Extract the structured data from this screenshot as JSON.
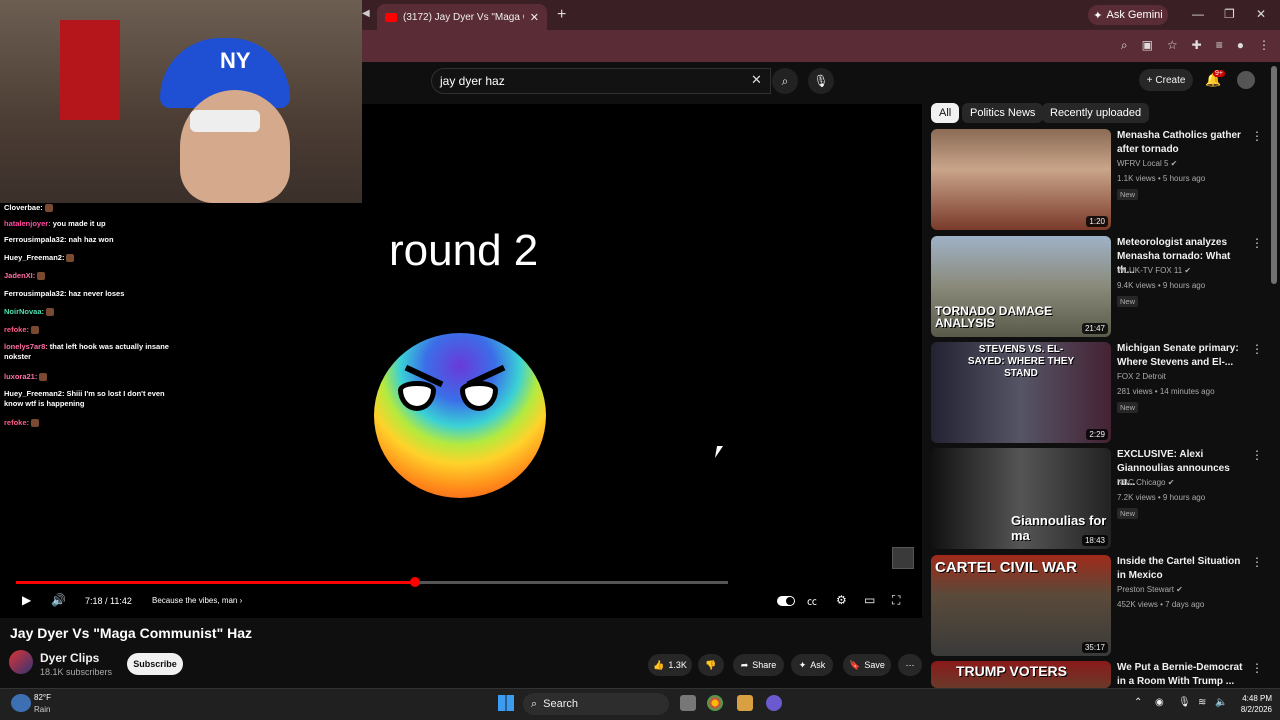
{
  "browser": {
    "tab_title": "(3172) Jay Dyer Vs \"Maga Comm",
    "ask_gemini": "Ask Gemini"
  },
  "header": {
    "search_value": "jay dyer haz",
    "create_label": "Create",
    "notif_count": "9+"
  },
  "chat": {
    "lines": [
      {
        "user": "Cloverbae:",
        "text": "",
        "color": "#ffffff"
      },
      {
        "user": "hatalenjoyer:",
        "text": "you made it up",
        "color": "#ff4aa0"
      },
      {
        "user": "Ferrousimpala32:",
        "text": "nah haz won",
        "color": "#ffffff"
      },
      {
        "user": "Huey_Freeman2:",
        "text": "",
        "color": "#ffffff"
      },
      {
        "user": "JadenXI:",
        "text": "",
        "color": "#ff6fa5"
      },
      {
        "user": "Ferrousimpala32:",
        "text": "haz never loses",
        "color": "#ffffff"
      },
      {
        "user": "NoirNovaa:",
        "text": "",
        "color": "#4ee0b0"
      },
      {
        "user": "refoke:",
        "text": "",
        "color": "#ff5c8a"
      },
      {
        "user": "lonelys7ar8:",
        "text": "that left hook was actually insane nokster",
        "color": "#ff6fa5"
      },
      {
        "user": "luxora21:",
        "text": "",
        "color": "#ff6fa5"
      },
      {
        "user": "Huey_Freeman2:",
        "text": "Shiii I'm so lost I don't even know wtf is happening",
        "color": "#ffffff"
      },
      {
        "user": "refoke:",
        "text": "",
        "color": "#ff5c8a"
      }
    ]
  },
  "video": {
    "overlay_text": "round 2",
    "progress": 0.63,
    "buffered": 1.0,
    "time": "7:18 / 11:42",
    "chapter": "Because the vibes, man",
    "title": "Jay Dyer Vs \"Maga Communist\" Haz",
    "channel": "Dyer Clips",
    "subscribers": "18.1K subscribers",
    "subscribe_label": "Subscribe",
    "likes": "1.3K",
    "share_label": "Share",
    "ask_label": "Ask",
    "save_label": "Save"
  },
  "chips": [
    "All",
    "Politics News",
    "Recently uploaded"
  ],
  "recommendations": [
    {
      "title": "Menasha Catholics gather after tornado",
      "channel": "WFRV Local 5",
      "verified": true,
      "meta": "1.1K views • 5 hours ago",
      "badge": "New",
      "duration": "1:20",
      "thumb_text": ""
    },
    {
      "title": "Meteorologist analyzes Menasha tornado: What th...",
      "channel": "WLUK-TV FOX 11",
      "verified": true,
      "meta": "9.4K views • 9 hours ago",
      "badge": "New",
      "duration": "21:47",
      "thumb_text": "TORNADO DAMAGE ANALYSIS"
    },
    {
      "title": "Michigan Senate primary: Where Stevens and El-...",
      "channel": "FOX 2 Detroit",
      "verified": false,
      "meta": "281 views • 14 minutes ago",
      "badge": "New",
      "duration": "2:29",
      "thumb_text": "STEVENS VS. EL-SAYED: WHERE THEY STAND"
    },
    {
      "title": "EXCLUSIVE: Alexi Giannoulias announces ru...",
      "channel": "NBC Chicago",
      "verified": true,
      "meta": "7.2K views • 9 hours ago",
      "badge": "New",
      "duration": "18:43",
      "thumb_text": "Giannoulias for ma"
    },
    {
      "title": "Inside the Cartel Situation in Mexico",
      "channel": "Preston Stewart",
      "verified": true,
      "meta": "452K views • 7 days ago",
      "badge": "",
      "duration": "35:17",
      "thumb_text": "CARTEL CIVIL WAR"
    },
    {
      "title": "We Put a Bernie-Democrat in a Room With Trump ...",
      "channel": "",
      "verified": false,
      "meta": "",
      "badge": "",
      "duration": "",
      "thumb_text": "TRUMP VOTERS"
    }
  ],
  "taskbar": {
    "temp": "82°F",
    "weather": "Rain",
    "search": "Search",
    "time": "4:48 PM",
    "date": "8/2/2026"
  }
}
